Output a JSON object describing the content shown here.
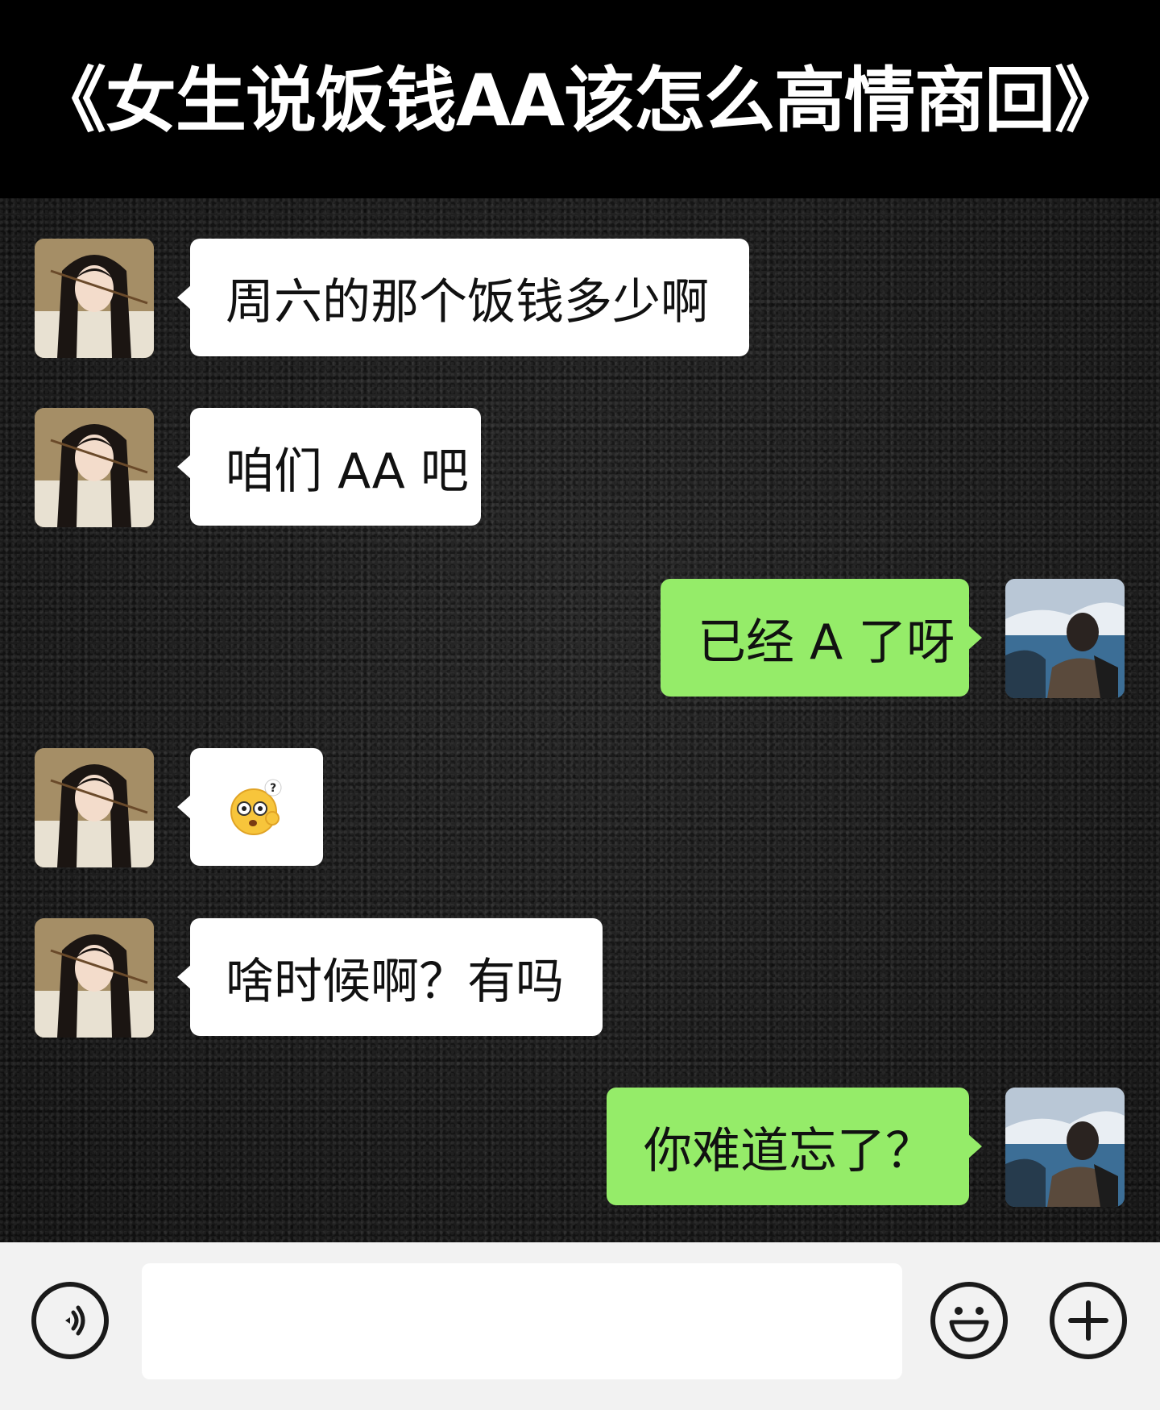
{
  "title": "《女生说饭钱AA该怎么高情商回》",
  "messages": [
    {
      "side": "in",
      "text": "周六的那个饭钱多少啊"
    },
    {
      "side": "in",
      "text": "咱们 AA 吧"
    },
    {
      "side": "out",
      "text": "已经 A 了呀"
    },
    {
      "side": "in",
      "emoji": "confused-face-emoji"
    },
    {
      "side": "in",
      "text": "啥时候啊？有吗"
    },
    {
      "side": "out",
      "text": "你难道忘了？"
    }
  ],
  "input_bar": {
    "placeholder": "",
    "voice_icon": "voice-icon",
    "emoji_icon": "smiley-icon",
    "plus_icon": "plus-icon"
  },
  "colors": {
    "incoming_bubble": "#ffffff",
    "outgoing_bubble": "#95ec69",
    "background": "#1c1c1c",
    "input_bar": "#f2f2f2"
  }
}
